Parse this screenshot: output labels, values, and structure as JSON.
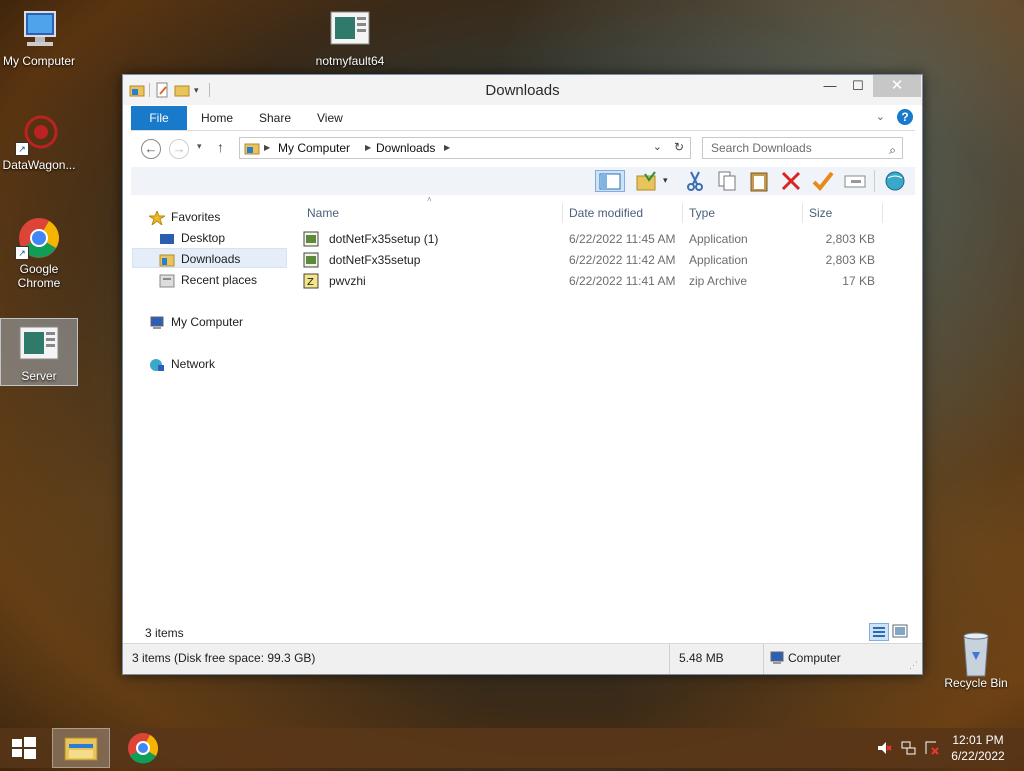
{
  "desktop": {
    "icons": [
      {
        "label": "My Computer"
      },
      {
        "label": "notmyfault64"
      },
      {
        "label": "DataWagon..."
      },
      {
        "label": "Google\nChrome"
      },
      {
        "label": "Server"
      },
      {
        "label": "Recycle Bin"
      }
    ]
  },
  "window": {
    "title": "Downloads",
    "controls": {
      "minimize": "—",
      "maximize": "☐",
      "close": "✕"
    }
  },
  "ribbon": {
    "tabs": [
      "File",
      "Home",
      "Share",
      "View"
    ],
    "help": "?"
  },
  "address": {
    "crumbs": [
      "My Computer",
      "Downloads"
    ],
    "search_placeholder": "Search Downloads"
  },
  "nav_pane": {
    "favorites": "Favorites",
    "items": [
      "Desktop",
      "Downloads",
      "Recent places"
    ],
    "computer": "My Computer",
    "network": "Network"
  },
  "file_list": {
    "columns": [
      "Name",
      "Date modified",
      "Type",
      "Size"
    ],
    "rows": [
      {
        "name": "dotNetFx35setup (1)",
        "date": "6/22/2022 11:45 AM",
        "type": "Application",
        "size": "2,803 KB"
      },
      {
        "name": "dotNetFx35setup",
        "date": "6/22/2022 11:42 AM",
        "type": "Application",
        "size": "2,803 KB"
      },
      {
        "name": "pwvzhi",
        "date": "6/22/2022 11:41 AM",
        "type": "zip Archive",
        "size": "17 KB"
      }
    ]
  },
  "status": {
    "items_count": "3 items",
    "detail": "3 items (Disk free space: 99.3 GB)",
    "size": "5.48 MB",
    "location": "Computer"
  },
  "taskbar": {
    "time": "12:01 PM",
    "date": "6/22/2022"
  },
  "colors": {
    "accent": "#1979ca",
    "selection": "#e5eef8"
  }
}
